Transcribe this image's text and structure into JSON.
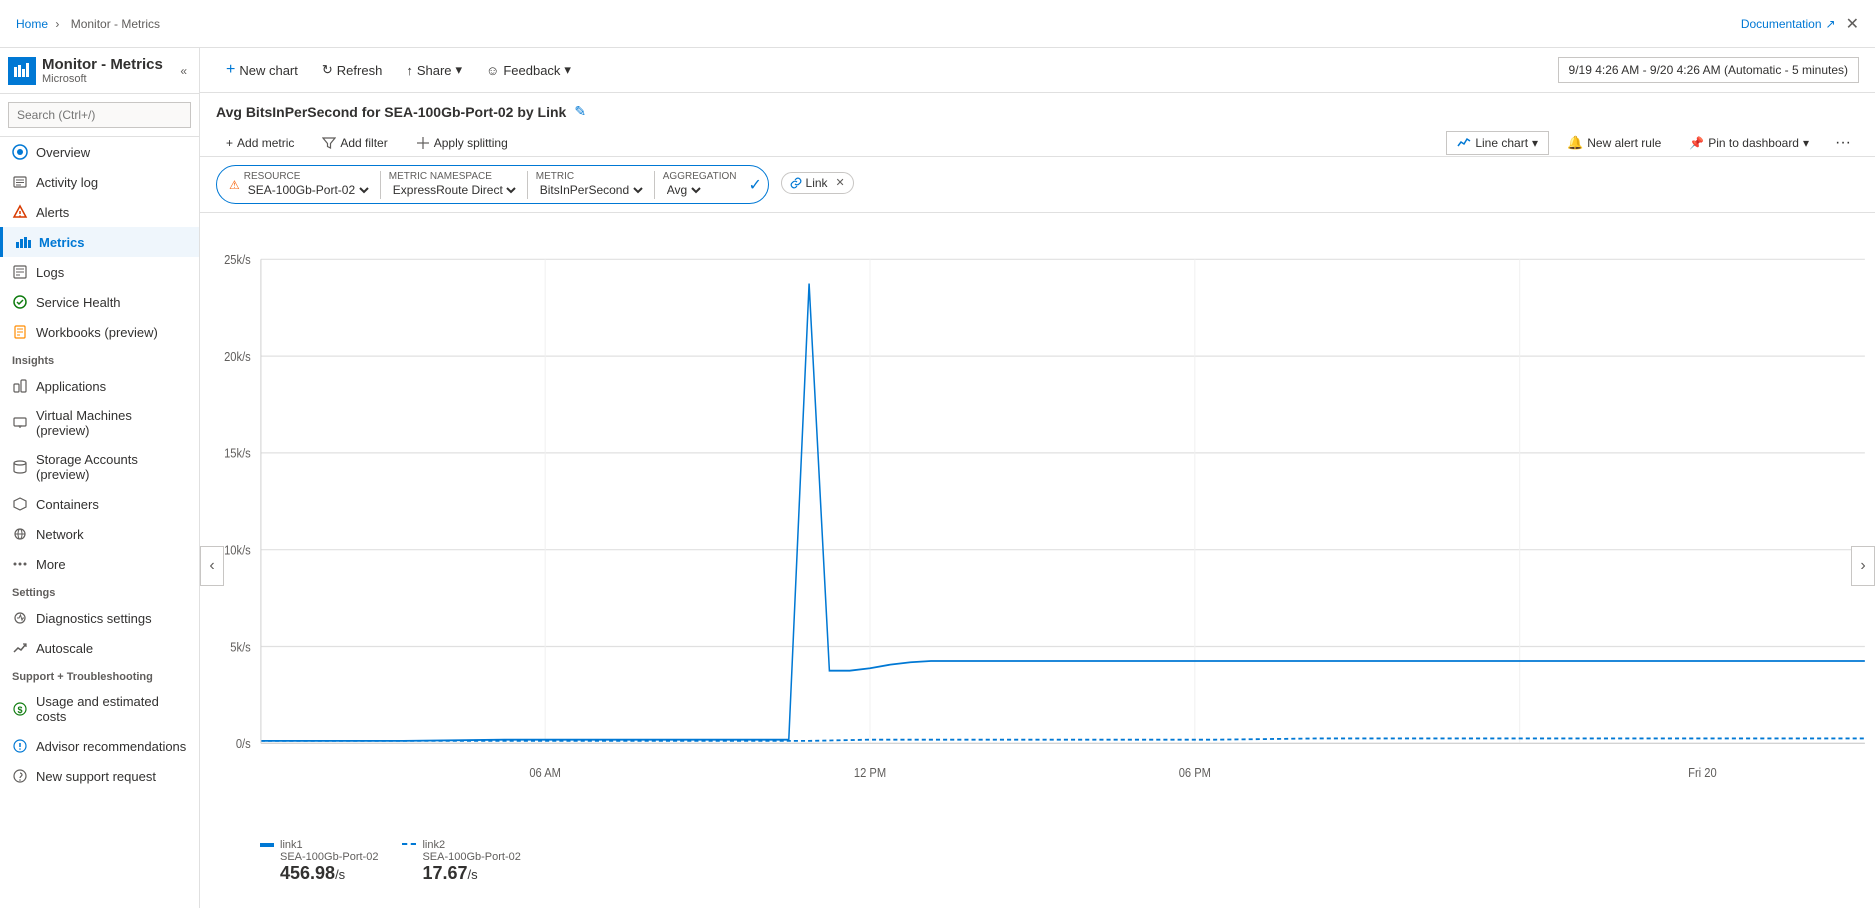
{
  "breadcrumb": {
    "home": "Home",
    "current": "Monitor - Metrics"
  },
  "app": {
    "title": "Monitor - Metrics",
    "subtitle": "Microsoft",
    "icon": "📊"
  },
  "topbar": {
    "documentation_label": "Documentation",
    "close_label": "✕"
  },
  "sidebar": {
    "search_placeholder": "Search (Ctrl+/)",
    "nav_items": [
      {
        "id": "overview",
        "label": "Overview",
        "icon": "overview"
      },
      {
        "id": "activity-log",
        "label": "Activity log",
        "icon": "activity"
      },
      {
        "id": "alerts",
        "label": "Alerts",
        "icon": "alerts"
      },
      {
        "id": "metrics",
        "label": "Metrics",
        "icon": "metrics",
        "active": true
      },
      {
        "id": "logs",
        "label": "Logs",
        "icon": "logs"
      },
      {
        "id": "service-health",
        "label": "Service Health",
        "icon": "health"
      },
      {
        "id": "workbooks",
        "label": "Workbooks (preview)",
        "icon": "workbooks"
      }
    ],
    "insights_label": "Insights",
    "insights_items": [
      {
        "id": "applications",
        "label": "Applications",
        "icon": "app"
      },
      {
        "id": "vms",
        "label": "Virtual Machines (preview)",
        "icon": "vm"
      },
      {
        "id": "storage",
        "label": "Storage Accounts (preview)",
        "icon": "storage"
      },
      {
        "id": "containers",
        "label": "Containers",
        "icon": "container"
      },
      {
        "id": "network",
        "label": "Network",
        "icon": "network"
      },
      {
        "id": "more",
        "label": "More",
        "icon": "more"
      }
    ],
    "settings_label": "Settings",
    "settings_items": [
      {
        "id": "diagnostics",
        "label": "Diagnostics settings",
        "icon": "diag"
      },
      {
        "id": "autoscale",
        "label": "Autoscale",
        "icon": "autoscale"
      }
    ],
    "support_label": "Support + Troubleshooting",
    "support_items": [
      {
        "id": "usage-costs",
        "label": "Usage and estimated costs",
        "icon": "usage"
      },
      {
        "id": "advisor",
        "label": "Advisor recommendations",
        "icon": "advisor"
      },
      {
        "id": "support",
        "label": "New support request",
        "icon": "support"
      }
    ]
  },
  "toolbar": {
    "new_chart": "New chart",
    "refresh": "Refresh",
    "share": "Share",
    "feedback": "Feedback",
    "date_range": "9/19 4:26 AM - 9/20 4:26 AM (Automatic - 5 minutes)"
  },
  "chart": {
    "title": "Avg BitsInPerSecond for SEA-100Gb-Port-02 by Link",
    "add_metric": "Add metric",
    "add_filter": "Add filter",
    "apply_splitting": "Apply splitting",
    "chart_type": "Line chart",
    "new_alert_rule": "New alert rule",
    "pin_to_dashboard": "Pin to dashboard",
    "more": "···",
    "resource_label": "RESOURCE",
    "resource_value": "SEA-100Gb-Port-02",
    "metric_namespace_label": "METRIC NAMESPACE",
    "metric_namespace_value": "ExpressRoute Direct...",
    "metric_label": "METRIC",
    "metric_value": "BitsInPerSecond",
    "aggregation_label": "AGGREGATION",
    "aggregation_value": "Avg",
    "tag_label": "Link",
    "y_labels": [
      "25k/s",
      "20k/s",
      "15k/s",
      "10k/s",
      "5k/s",
      "0/s"
    ],
    "x_labels": [
      "06 AM",
      "12 PM",
      "06 PM",
      "Fri 20"
    ],
    "legend": [
      {
        "key": "link1",
        "label": "link1",
        "sublabel": "SEA-100Gb-Port-02",
        "value": "456.98",
        "unit": "/s",
        "color": "#0078d4",
        "dashed": false
      },
      {
        "key": "link2",
        "label": "link2",
        "sublabel": "SEA-100Gb-Port-02",
        "value": "17.67",
        "unit": "/s",
        "color": "#0078d4",
        "dashed": true
      }
    ]
  }
}
